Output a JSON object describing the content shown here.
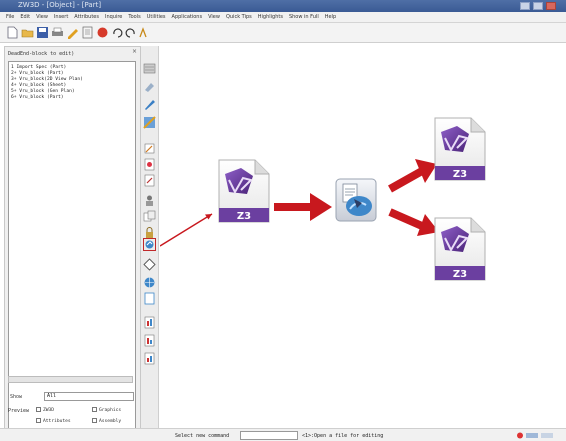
{
  "window": {
    "title": "ZW3D - [Object] - [Part]"
  },
  "menu": [
    "File",
    "Edit",
    "View",
    "Insert",
    "Attributes",
    "Inquire",
    "Tools",
    "Utilities",
    "Applications",
    "View",
    "Quick Tips",
    "Highlights",
    "Show in Full",
    "Help"
  ],
  "tree": {
    "header": "DeadEnd-block to edit)",
    "close": "×",
    "items": [
      "1  Import Spec  (Part)",
      "2+ Vru_block  (Part)",
      "3+ Vru_block(2D  View Plan)",
      "4+ Vru_block  (Sheet)",
      "5+ Vru_block  (Gen Plan)",
      "6+ Vru_block  (Part)"
    ]
  },
  "show": {
    "label": "Show",
    "value": "All"
  },
  "filter": {
    "label": "Preview",
    "opts": [
      "ZW3D",
      "Graphics",
      "Attributes",
      "Assembly"
    ]
  },
  "status": {
    "cmd_label": "Select new command",
    "text": "<1>:Open a file for editing"
  },
  "diagram": {
    "badge": "Z3",
    "colors": {
      "purple": "#5a2d8c",
      "arrow": "#c8181e",
      "badge": "#6b3fa0"
    }
  }
}
